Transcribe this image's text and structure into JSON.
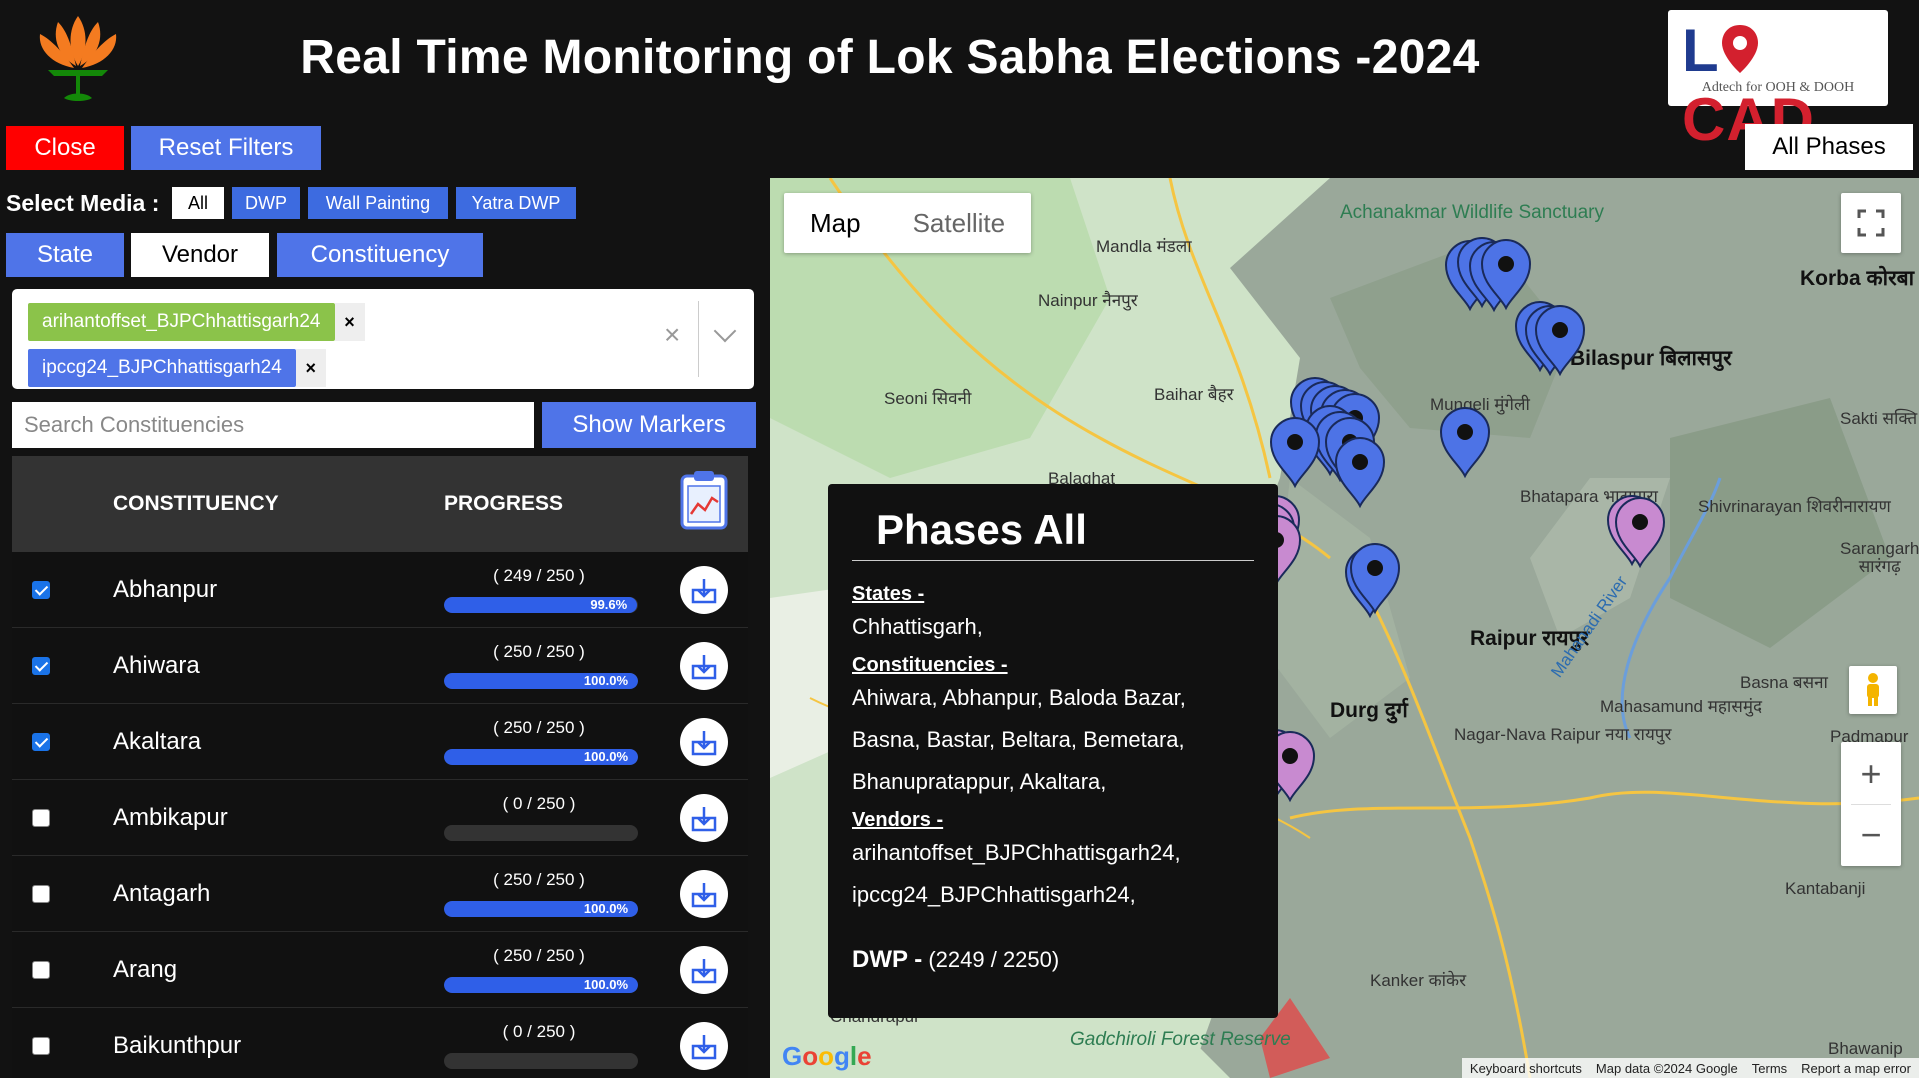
{
  "header": {
    "title": "Real Time Monitoring of Lok Sabha Elections -2024",
    "locad_word_a": "L",
    "locad_word_b": "CAD",
    "locad_tagline": "Adtech for OOH & DOOH"
  },
  "buttons": {
    "close": "Close",
    "reset": "Reset Filters",
    "phases": "All Phases",
    "show_markers": "Show Markers"
  },
  "media": {
    "label": "Select Media :",
    "options": [
      "All",
      "DWP",
      "Wall Painting",
      "Yatra DWP"
    ],
    "selected": "All"
  },
  "filter_tabs": [
    "State",
    "Vendor",
    "Constituency"
  ],
  "active_tab": "Vendor",
  "selected_vendors": [
    "arihantoffset_BJPChhattisgarh24",
    "ipccg24_BJPChhattisgarh24"
  ],
  "chip_remove": "×",
  "clear_all": "×",
  "search": {
    "placeholder": "Search Constituencies"
  },
  "table": {
    "col_constituency": "CONSTITUENCY",
    "col_progress": "PROGRESS",
    "rows": [
      {
        "name": "Abhanpur",
        "checked": true,
        "count": "( 249 / 250 )",
        "pct_label": "99.6%",
        "fraction": 0.996
      },
      {
        "name": "Ahiwara",
        "checked": true,
        "count": "( 250 / 250 )",
        "pct_label": "100.0%",
        "fraction": 1.0
      },
      {
        "name": "Akaltara",
        "checked": true,
        "count": "( 250 / 250 )",
        "pct_label": "100.0%",
        "fraction": 1.0
      },
      {
        "name": "Ambikapur",
        "checked": false,
        "count": "( 0 / 250 )",
        "pct_label": "",
        "fraction": 0
      },
      {
        "name": "Antagarh",
        "checked": false,
        "count": "( 250 / 250 )",
        "pct_label": "100.0%",
        "fraction": 1.0
      },
      {
        "name": "Arang",
        "checked": false,
        "count": "( 250 / 250 )",
        "pct_label": "100.0%",
        "fraction": 1.0
      },
      {
        "name": "Baikunthpur",
        "checked": false,
        "count": "( 0 / 250 )",
        "pct_label": "",
        "fraction": 0
      }
    ]
  },
  "map": {
    "type_map": "Map",
    "type_satellite": "Satellite",
    "zoom_in": "+",
    "zoom_out": "−",
    "labels": [
      "Achanakmar Wildlife Sanctuary",
      "Korba कोरबा",
      "Bilaspur बिलासपुर",
      "Mungeli मुंगेली",
      "Mandla मंडला",
      "Nainpur नैनपुर",
      "Seoni सिवनी",
      "Baihar बैहर",
      "Balaghat",
      "Raipur रायपुर",
      "Durg दुर्ग",
      "Bhatapara भाटापारा",
      "Shivrinarayan शिवरीनारायण",
      "Mahasamund महासमुंद",
      "Basna बसना",
      "Padmapur",
      "Kanker कांकेर",
      "Kantabanji",
      "Sakti सक्ति",
      "Sarangarh सारंगढ़",
      "Nagar-Nava Raipur नया रायपुर",
      "Gadchiroli Forest Reserve",
      "Chandrapur",
      "Mahanadi River",
      "Bhawanip"
    ],
    "attribution": [
      "Keyboard shortcuts",
      "Map data ©2024 Google",
      "Terms",
      "Report a map error"
    ],
    "google": "Google"
  },
  "info_panel": {
    "title": "Phases All",
    "states_label": "States -",
    "states": "Chhattisgarh,",
    "constituencies_label": "Constituencies -",
    "constituencies": "Ahiwara, Abhanpur, Baloda Bazar, Basna, Bastar, Beltara, Bemetara, Bhanupratappur, Akaltara,",
    "vendors_label": "Vendors -",
    "vendors": [
      "arihantoffset_BJPChhattisgarh24,",
      "ipccg24_BJPChhattisgarh24,"
    ],
    "dwp_label": "DWP -",
    "dwp_value": "(2249 / 2250)"
  },
  "colors": {
    "close": "#ff0000",
    "primary": "#4f74e8",
    "vendor_chip_1": "#8bc34a",
    "vendor_chip_2": "#4f74e8",
    "marker_blue": "#4d73e6",
    "marker_pink": "#c88ad0"
  }
}
